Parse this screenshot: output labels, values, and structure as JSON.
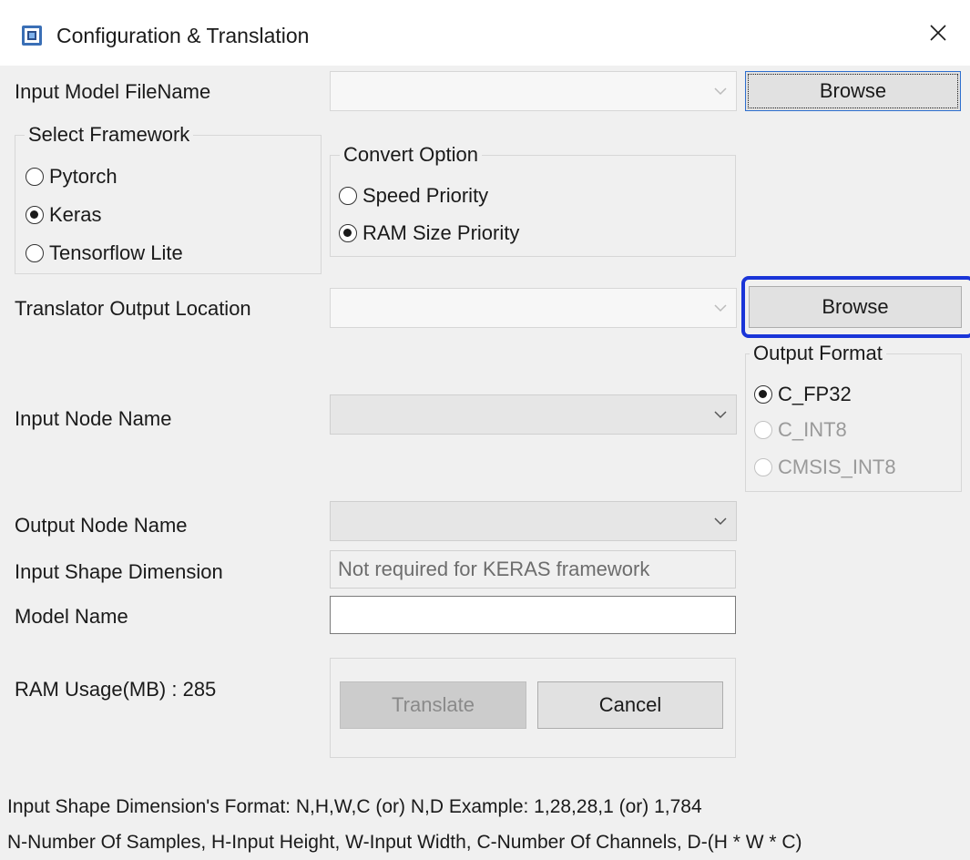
{
  "window": {
    "title": "Configuration & Translation",
    "icon": "app-chip-icon",
    "close_icon": "close-icon"
  },
  "input_model": {
    "label": "Input Model FileName",
    "value": "",
    "browse_label": "Browse"
  },
  "framework": {
    "legend": "Select Framework",
    "options": [
      "Pytorch",
      "Keras",
      "Tensorflow Lite"
    ],
    "selected": "Keras"
  },
  "convert_option": {
    "legend": "Convert Option",
    "options": [
      "Speed Priority",
      "RAM Size Priority"
    ],
    "selected": "RAM Size Priority"
  },
  "output_location": {
    "label": "Translator Output Location",
    "value": "",
    "browse_label": "Browse"
  },
  "output_format": {
    "legend": "Output Format",
    "options": [
      "C_FP32",
      "C_INT8",
      "CMSIS_INT8"
    ],
    "selected": "C_FP32"
  },
  "input_node": {
    "label": "Input Node Name",
    "value": ""
  },
  "output_node": {
    "label": "Output Node Name",
    "value": ""
  },
  "input_shape": {
    "label": "Input Shape Dimension",
    "placeholder": "Not required for KERAS framework"
  },
  "model_name": {
    "label": "Model Name",
    "value": ""
  },
  "ram_usage": {
    "label": "RAM Usage(MB) : 285"
  },
  "actions": {
    "translate_label": "Translate",
    "cancel_label": "Cancel"
  },
  "footer": {
    "line1": "Input Shape Dimension's Format: N,H,W,C (or) N,D    Example: 1,28,28,1 (or) 1,784",
    "line2": "N-Number Of Samples, H-Input Height, W-Input Width, C-Number Of Channels, D-(H * W * C)"
  },
  "colors": {
    "highlight": "#1a35d8",
    "background": "#f0f0f0",
    "button": "#e1e1e1"
  }
}
